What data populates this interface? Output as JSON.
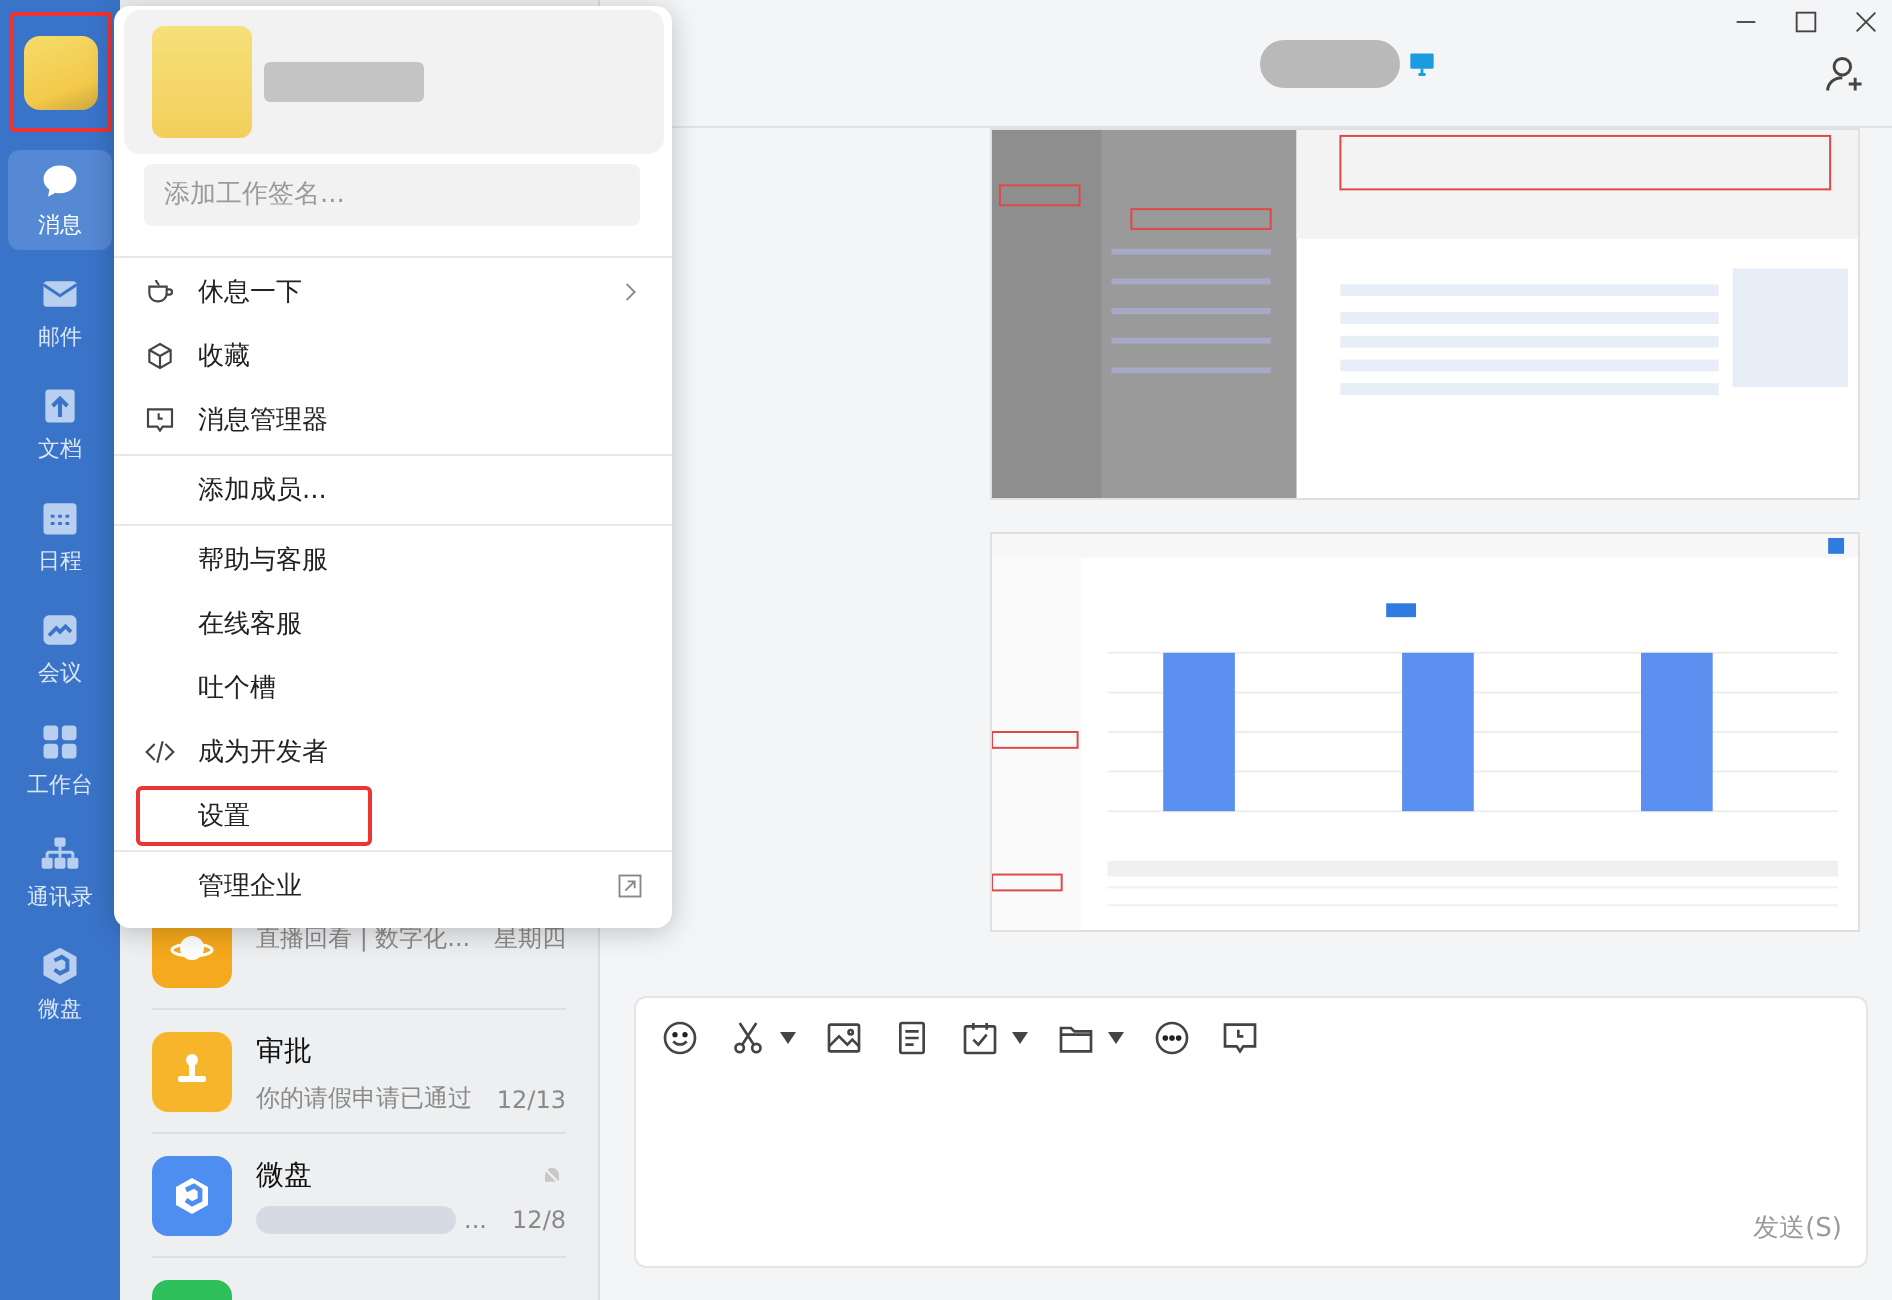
{
  "sidebar": {
    "avatar_highlighted": true,
    "items": [
      {
        "label": "消息",
        "selected": true
      },
      {
        "label": "邮件",
        "selected": false
      },
      {
        "label": "文档",
        "selected": false
      },
      {
        "label": "日程",
        "selected": false
      },
      {
        "label": "会议",
        "selected": false
      },
      {
        "label": "工作台",
        "selected": false
      },
      {
        "label": "通讯录",
        "selected": false
      },
      {
        "label": "微盘",
        "selected": false
      }
    ]
  },
  "profile_menu": {
    "signature_placeholder": "添加工作签名...",
    "groups": [
      [
        {
          "label": "休息一下",
          "submenu": true,
          "external": false,
          "highlighted": false
        },
        {
          "label": "收藏",
          "submenu": false,
          "external": false,
          "highlighted": false
        },
        {
          "label": "消息管理器",
          "submenu": false,
          "external": false,
          "highlighted": false
        }
      ],
      [
        {
          "label": "添加成员...",
          "submenu": false,
          "external": false,
          "highlighted": false
        }
      ],
      [
        {
          "label": "帮助与客服",
          "submenu": false,
          "external": false,
          "highlighted": false
        },
        {
          "label": "在线客服",
          "submenu": false,
          "external": false,
          "highlighted": false
        },
        {
          "label": "吐个槽",
          "submenu": false,
          "external": false,
          "highlighted": false
        },
        {
          "label": "成为开发者",
          "submenu": false,
          "external": false,
          "highlighted": false
        },
        {
          "label": "设置",
          "submenu": false,
          "external": false,
          "highlighted": true
        }
      ],
      [
        {
          "label": "管理企业",
          "submenu": false,
          "external": true,
          "highlighted": false
        }
      ]
    ]
  },
  "chat_list": [
    {
      "color": "#f5a91c",
      "preview": "直播回看 | 数字化...",
      "time": "星期四",
      "muted": false,
      "preview_redacted": false
    },
    {
      "title": "审批",
      "color": "#f7b52c",
      "preview": "你的请假申请已通过",
      "time": "12/13",
      "muted": false,
      "preview_redacted": false
    },
    {
      "title": "微盘",
      "color": "#4d8ef0",
      "preview": "...",
      "time": "12/8",
      "muted": true,
      "preview_redacted": true
    },
    {
      "color": "#2fbf5a",
      "muted": false,
      "preview_redacted": false
    }
  ],
  "chat_header": {
    "device_online": true
  },
  "messages": [
    {
      "kind": "table"
    },
    {
      "kind": "chart"
    }
  ],
  "composer": {
    "send_label": "发送(S)"
  }
}
